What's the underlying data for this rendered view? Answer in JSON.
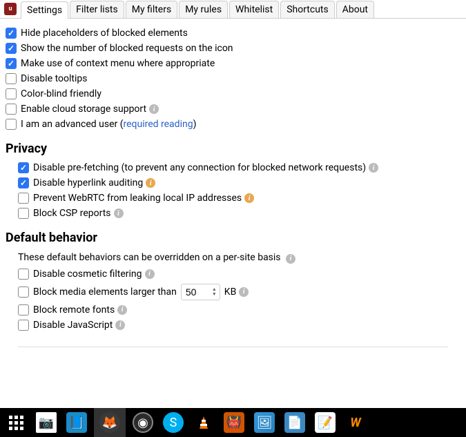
{
  "tabs": {
    "settings": "Settings",
    "filter_lists": "Filter lists",
    "my_filters": "My filters",
    "my_rules": "My rules",
    "whitelist": "Whitelist",
    "shortcuts": "Shortcuts",
    "about": "About"
  },
  "general": {
    "hide_placeholders": "Hide placeholders of blocked elements",
    "show_count": "Show the number of blocked requests on the icon",
    "context_menu": "Make use of context menu where appropriate",
    "disable_tooltips": "Disable tooltips",
    "color_blind": "Color-blind friendly",
    "cloud_storage": "Enable cloud storage support",
    "advanced_prefix": "I am an advanced user (",
    "advanced_link": "required reading",
    "advanced_suffix": ")"
  },
  "privacy": {
    "heading": "Privacy",
    "prefetch": "Disable pre-fetching (to prevent any connection for blocked network requests)",
    "hyperlink": "Disable hyperlink auditing",
    "webrtc": "Prevent WebRTC from leaking local IP addresses",
    "csp": "Block CSP reports"
  },
  "default_behavior": {
    "heading": "Default behavior",
    "subtext": "These default behaviors can be overridden on a per-site basis",
    "cosmetic": "Disable cosmetic filtering",
    "media_prefix": "Block media elements larger than",
    "media_value": "50",
    "media_suffix": "KB",
    "remote_fonts": "Block remote fonts",
    "javascript": "Disable JavaScript"
  },
  "taskbar": {
    "apps": "Applications",
    "camera": "Camera",
    "kde": "KDE",
    "firefox": "Firefox",
    "steam": "Steam",
    "skype": "Skype",
    "vlc": "VLC",
    "reddit": "App",
    "screenshot": "Screenshot",
    "notes": "Notes",
    "notepad": "Notepad",
    "wx": "Wx"
  }
}
